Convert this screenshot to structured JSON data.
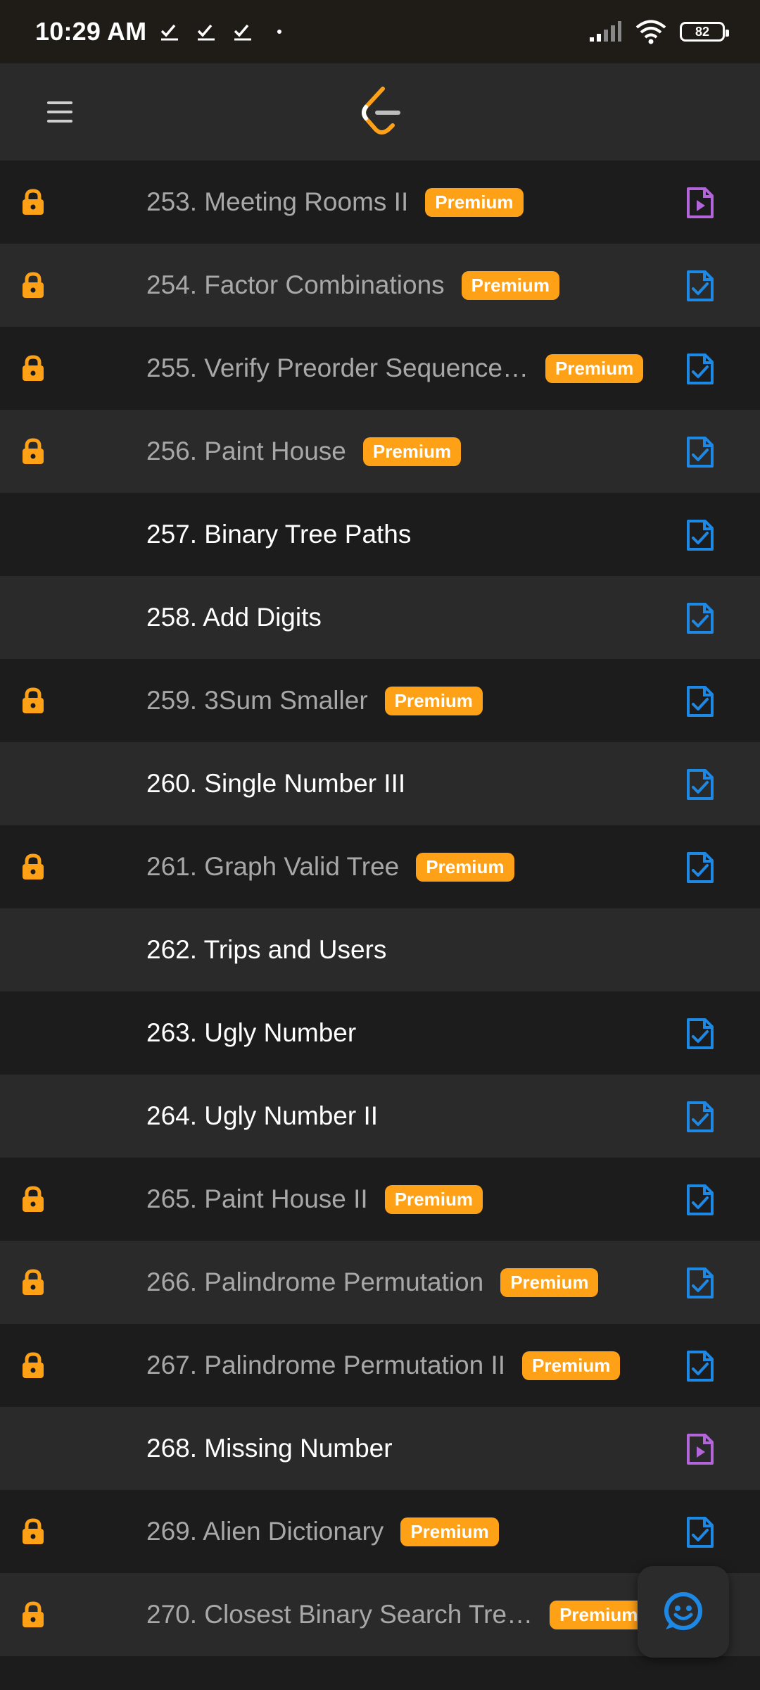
{
  "status_bar": {
    "time": "10:29 AM",
    "battery": "82"
  },
  "colors": {
    "premium": "#ffa116",
    "lock": "#ffa116",
    "solution_doc": "#1e88e5",
    "solution_video": "#b366d9"
  },
  "problems": [
    {
      "title": "253. Meeting Rooms II",
      "locked": true,
      "premium": "Premium",
      "solution_icon": "video-solution-icon"
    },
    {
      "title": "254. Factor Combinations",
      "locked": true,
      "premium": "Premium",
      "solution_icon": "doc-solution-icon"
    },
    {
      "title": "255. Verify Preorder Sequence…",
      "locked": true,
      "premium": "Premium",
      "solution_icon": "doc-solution-icon"
    },
    {
      "title": "256. Paint House",
      "locked": true,
      "premium": "Premium",
      "solution_icon": "doc-solution-icon"
    },
    {
      "title": "257. Binary Tree Paths",
      "locked": false,
      "premium": "",
      "solution_icon": "doc-solution-icon"
    },
    {
      "title": "258. Add Digits",
      "locked": false,
      "premium": "",
      "solution_icon": "doc-solution-icon"
    },
    {
      "title": "259. 3Sum Smaller",
      "locked": true,
      "premium": "Premium",
      "solution_icon": "doc-solution-icon"
    },
    {
      "title": "260. Single Number III",
      "locked": false,
      "premium": "",
      "solution_icon": "doc-solution-icon"
    },
    {
      "title": "261. Graph Valid Tree",
      "locked": true,
      "premium": "Premium",
      "solution_icon": "doc-solution-icon"
    },
    {
      "title": "262. Trips and Users",
      "locked": false,
      "premium": "",
      "solution_icon": ""
    },
    {
      "title": "263. Ugly Number",
      "locked": false,
      "premium": "",
      "solution_icon": "doc-solution-icon"
    },
    {
      "title": "264. Ugly Number II",
      "locked": false,
      "premium": "",
      "solution_icon": "doc-solution-icon"
    },
    {
      "title": "265. Paint House II",
      "locked": true,
      "premium": "Premium",
      "solution_icon": "doc-solution-icon"
    },
    {
      "title": "266. Palindrome Permutation",
      "locked": true,
      "premium": "Premium",
      "solution_icon": "doc-solution-icon"
    },
    {
      "title": "267. Palindrome Permutation II",
      "locked": true,
      "premium": "Premium",
      "solution_icon": "doc-solution-icon"
    },
    {
      "title": "268. Missing Number",
      "locked": false,
      "premium": "",
      "solution_icon": "video-solution-icon"
    },
    {
      "title": "269. Alien Dictionary",
      "locked": true,
      "premium": "Premium",
      "solution_icon": "doc-solution-icon"
    },
    {
      "title": "270. Closest Binary Search Tre…",
      "locked": true,
      "premium": "Premium",
      "solution_icon": ""
    }
  ]
}
